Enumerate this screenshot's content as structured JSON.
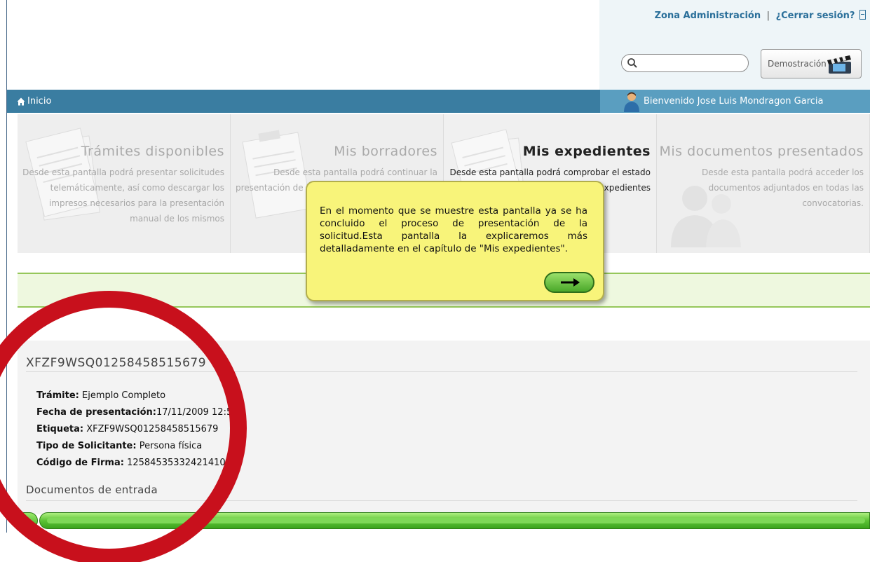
{
  "header": {
    "admin_link": "Zona Administración",
    "separator": "|",
    "logout_link": "¿Cerrar sesión?",
    "search": {
      "value": "",
      "placeholder": ""
    },
    "demo_button": "Demostración"
  },
  "nav": {
    "home": "Inicio",
    "welcome": "Bienvenido Jose Luis Mondragon Garcia"
  },
  "panels": [
    {
      "title": "Trámites disponibles",
      "desc": "Desde esta pantalla podrá presentar solicitudes telemáticamente, así como descargar los impresos necesarios para la presentación manual de los mismos"
    },
    {
      "title": "Mis borradores",
      "desc": "Desde esta pantalla podrá continuar la presentación de los trámites que se encuentran en estado borrador"
    },
    {
      "title": "Mis expedientes",
      "desc": "Desde esta pantalla podrá comprobar el estado en que se encuentran sus expedientes"
    },
    {
      "title": "Mis documentos presentados",
      "desc": "Desde esta pantalla podrá acceder los documentos adjuntados en todas las convocatorias."
    }
  ],
  "active_panel": "Mis expedientes",
  "tooltip": {
    "text": "En el momento que se muestre esta pantalla ya se ha concluido el proceso de presentación de la solicitud.Esta pantalla la explicaremos más detalladamente en el capítulo de \"Mis expedientes\"."
  },
  "expediente": {
    "title": "XFZF9WSQ01258458515679",
    "fields": [
      {
        "label": "Trámite:",
        "value": "Ejemplo Completo"
      },
      {
        "label": "Fecha de presentación:",
        "value": "17/11/2009 12:52"
      },
      {
        "label": "Etiqueta:",
        "value": "XFZF9WSQ01258458515679"
      },
      {
        "label": "Tipo de Solicitante:",
        "value": "Persona física"
      },
      {
        "label": "Código de Firma:",
        "value": "12584535332421410"
      }
    ],
    "docs_title": "Documentos de entrada"
  },
  "colors": {
    "nav_bar": "#3a7da1",
    "tooltip_bg": "#f8f47a",
    "annotation_circle": "#c8101c",
    "progress_green": "#5cc235"
  }
}
